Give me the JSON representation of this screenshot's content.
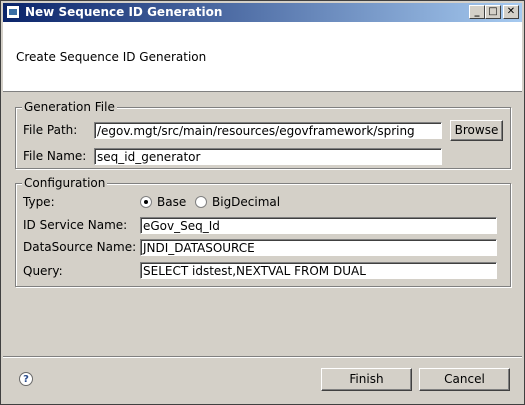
{
  "window": {
    "title": "New Sequence ID Generation",
    "controls": {
      "minimize": "_",
      "maximize": "□",
      "close": "✕"
    }
  },
  "header": {
    "message": "Create Sequence ID Generation"
  },
  "generation_file": {
    "group_label": "Generation File",
    "file_path_label": "File Path:",
    "file_path_value": "/egov.mgt/src/main/resources/egovframework/spring",
    "browse_label": "Browse",
    "file_name_label": "File Name:",
    "file_name_value": "seq_id_generator"
  },
  "configuration": {
    "group_label": "Configuration",
    "type_label": "Type:",
    "type_options": [
      {
        "label": "Base",
        "selected": true
      },
      {
        "label": "BigDecimal",
        "selected": false
      }
    ],
    "id_service_label": "ID Service Name:",
    "id_service_value": "eGov_Seq_Id",
    "datasource_label": "DataSource Name:",
    "datasource_value": "JNDI_DATASOURCE",
    "query_label": "Query:",
    "query_value": "SELECT idstest,NEXTVAL FROM DUAL"
  },
  "footer": {
    "help_icon": "?",
    "finish_label": "Finish",
    "cancel_label": "Cancel"
  }
}
